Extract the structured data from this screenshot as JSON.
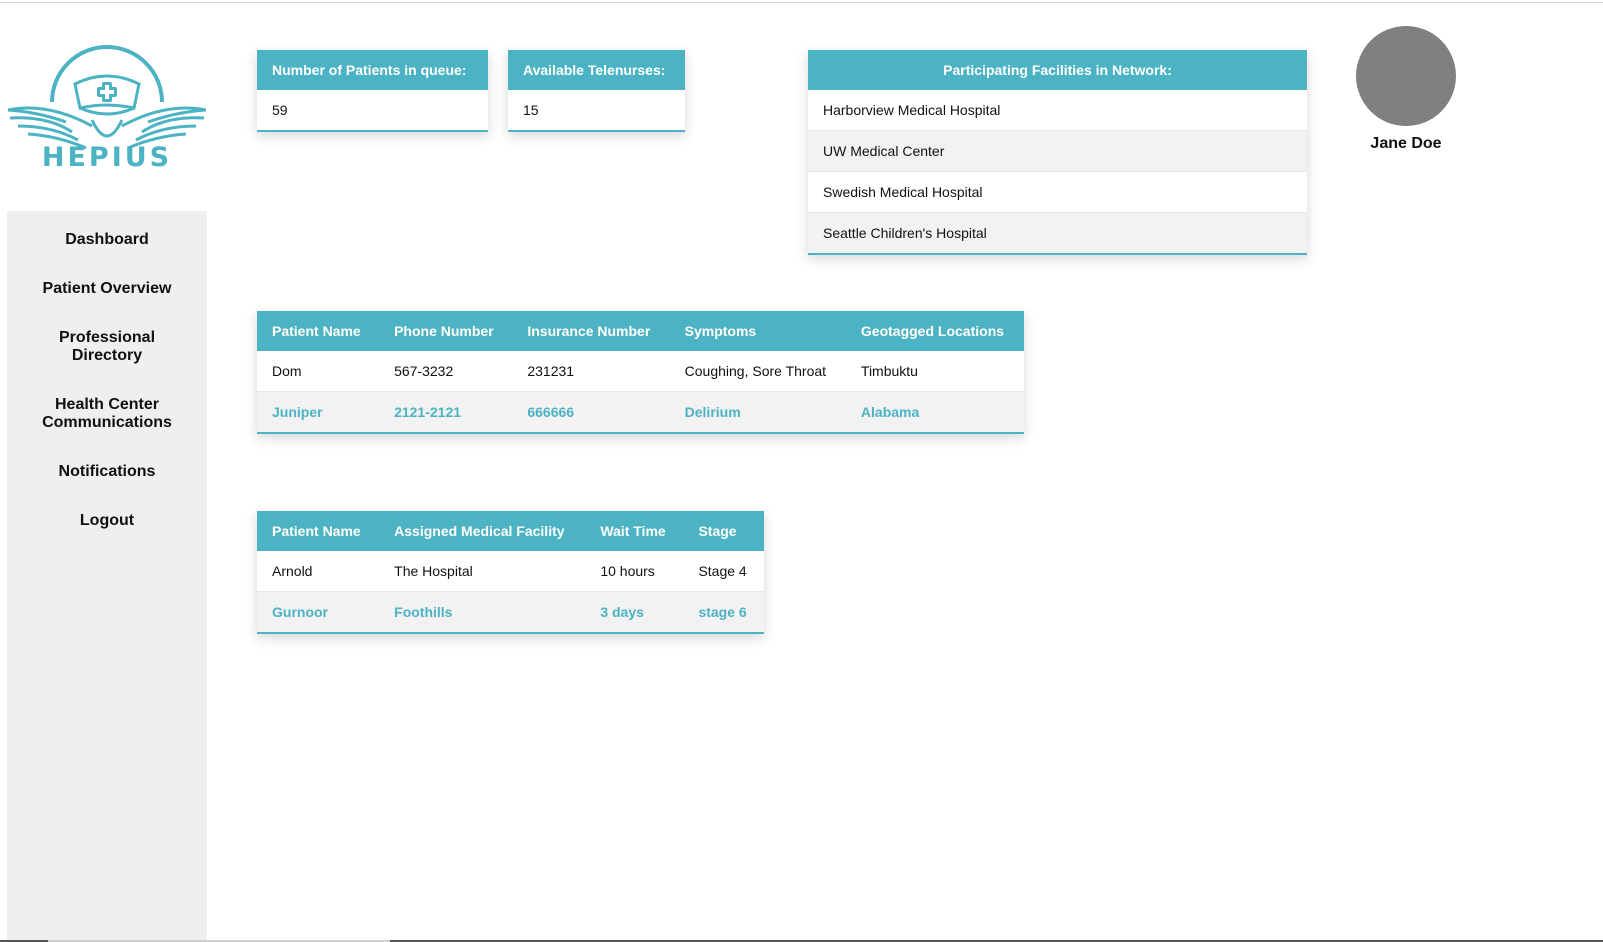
{
  "brand": {
    "name": "HEPIUS",
    "accent_color": "#4bb3c3"
  },
  "sidebar": {
    "items": [
      {
        "label": "Dashboard"
      },
      {
        "label": "Patient Overview"
      },
      {
        "label": "Professional Directory"
      },
      {
        "label": "Health Center Communications"
      },
      {
        "label": "Notifications"
      },
      {
        "label": "Logout"
      }
    ]
  },
  "stats": {
    "queue": {
      "label": "Number of Patients in queue:",
      "value": "59"
    },
    "telenurses": {
      "label": "Available Telenurses:",
      "value": "15"
    }
  },
  "facilities": {
    "title": "Participating Facilities in Network:",
    "items": [
      "Harborview Medical Hospital",
      "UW Medical Center",
      "Swedish Medical Hospital",
      "Seattle Children's Hospital"
    ]
  },
  "user": {
    "name": "Jane Doe"
  },
  "patients_table": {
    "headers": [
      "Patient Name",
      "Phone Number",
      "Insurance Number",
      "Symptoms",
      "Geotagged Locations"
    ],
    "rows": [
      [
        "Dom",
        "567-3232",
        "231231",
        "Coughing, Sore Throat",
        "Timbuktu"
      ],
      [
        "Juniper",
        "2121-2121",
        "666666",
        "Delirium",
        "Alabama"
      ]
    ]
  },
  "wait_table": {
    "headers": [
      "Patient Name",
      "Assigned Medical Facility",
      "Wait Time",
      "Stage"
    ],
    "rows": [
      [
        "Arnold",
        "The Hospital",
        "10 hours",
        "Stage 4"
      ],
      [
        "Gurnoor",
        "Foothills",
        "3 days",
        "stage 6"
      ]
    ]
  }
}
